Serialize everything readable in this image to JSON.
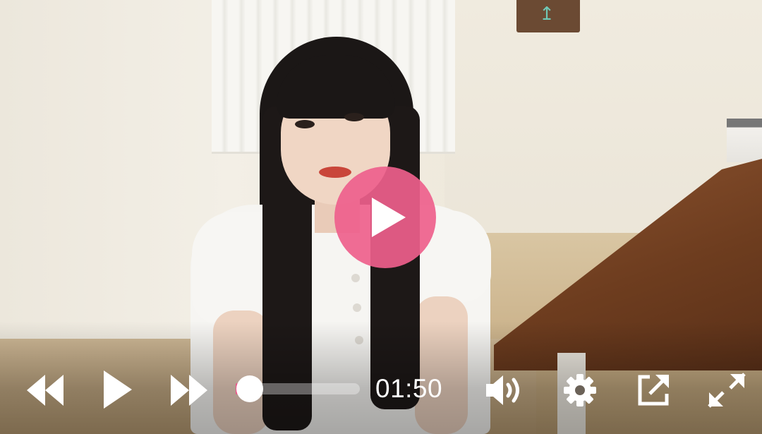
{
  "player": {
    "current_time": "01:50",
    "progress_fraction": 0.02,
    "accent_color": "#ee608c",
    "progress_color": "#e8588a"
  },
  "icons": {
    "big_play": "play-icon",
    "rewind": "rewind-icon",
    "play": "play-icon",
    "fast_forward": "fast-forward-icon",
    "volume": "volume-icon",
    "settings": "gear-icon",
    "share": "external-link-icon",
    "fullscreen": "fullscreen-icon"
  }
}
